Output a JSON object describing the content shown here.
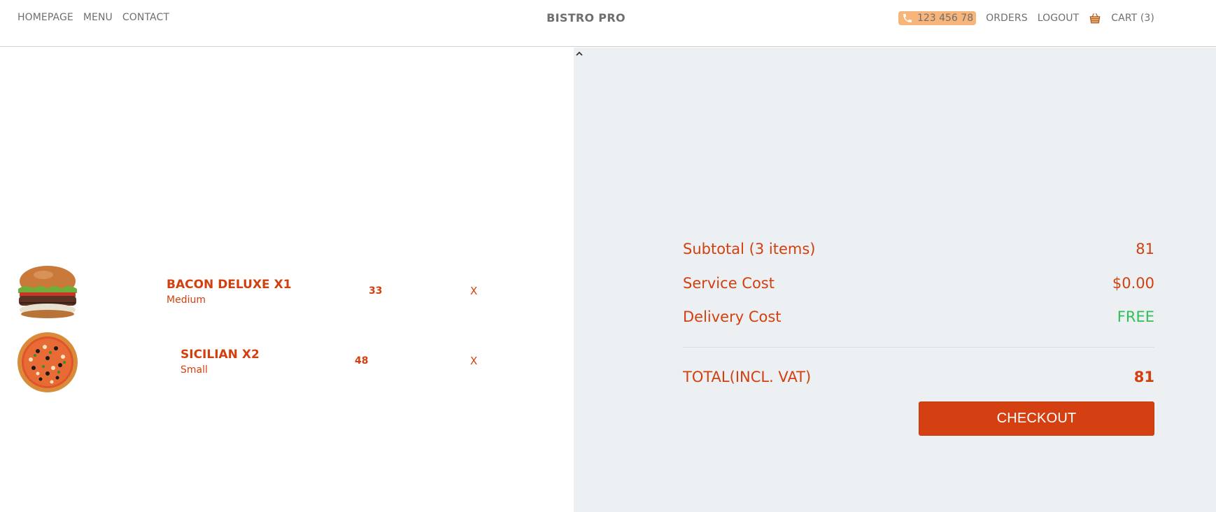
{
  "nav": {
    "links": [
      "HOMEPAGE",
      "MENU",
      "CONTACT"
    ],
    "brand": "BISTRO PRO",
    "phone": "123 456 78",
    "orders": "ORDERS",
    "logout": "LOGOUT",
    "cart": "CART (3)"
  },
  "cart_items": [
    {
      "name": "BACON DELUXE X1",
      "size": "Medium",
      "price": "33",
      "remove": "X",
      "image": "burger"
    },
    {
      "name": "SICILIAN X2",
      "size": "Small",
      "price": "48",
      "remove": "X",
      "image": "pizza"
    }
  ],
  "summary": {
    "subtotal_label": "Subtotal (3 items)",
    "subtotal_value": "81",
    "service_label": "Service Cost",
    "service_value": "$0.00",
    "delivery_label": "Delivery Cost",
    "delivery_value": "FREE",
    "total_label": "TOTAL(INCL. VAT)",
    "total_value": "81",
    "checkout_label": "CHECKOUT"
  },
  "colors": {
    "accent": "#d2400f",
    "free": "#2fbf58",
    "phone_badge": "#f7b57a",
    "panel_bg": "#ecf0f2"
  },
  "icons": [
    "phone-icon",
    "cart-icon",
    "chevron-up-icon"
  ]
}
